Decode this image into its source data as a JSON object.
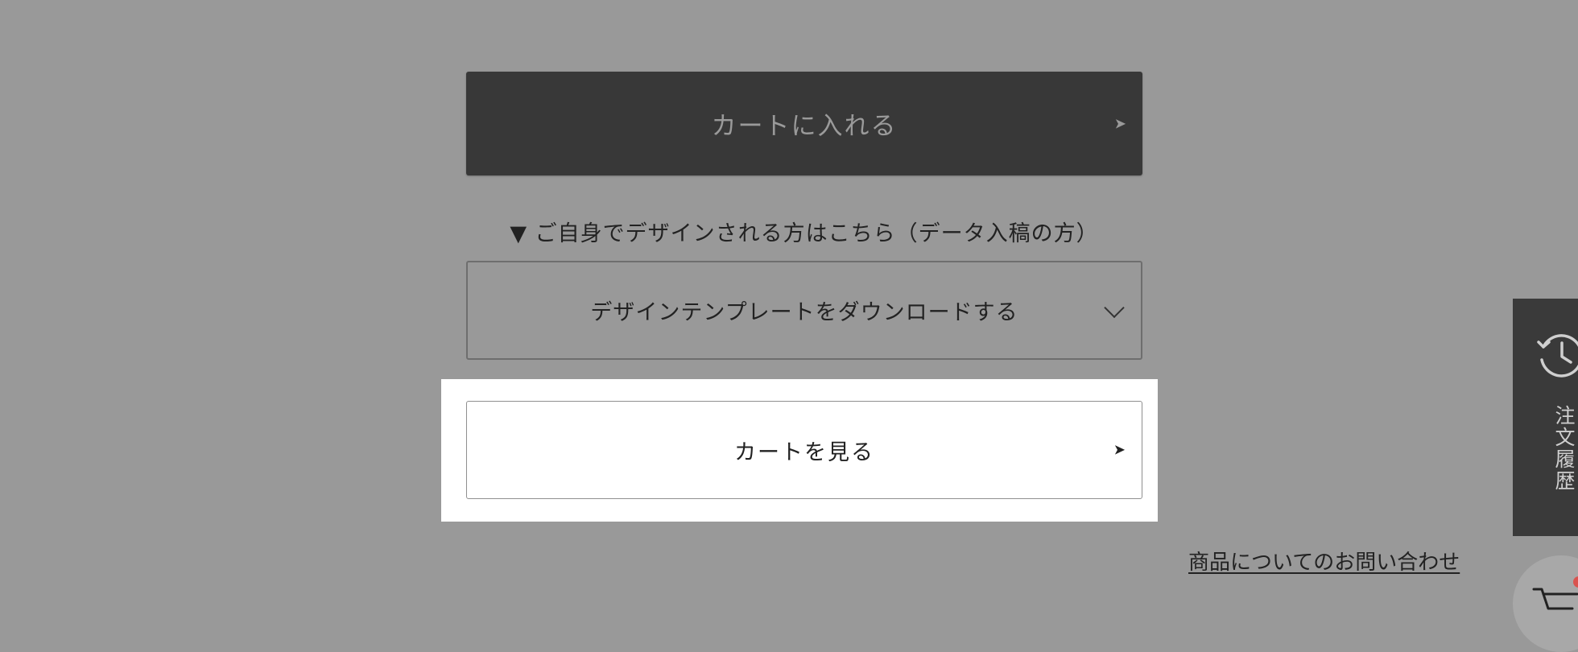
{
  "buttons": {
    "add_to_cart": "カートに入れる",
    "add_to_cart_arrow": "➤",
    "view_cart": "カートを見る",
    "view_cart_arrow": "➤"
  },
  "design_note": "▼ ご自身でデザインされる方はこちら（データ入稿の方）",
  "template_download": {
    "label": "デザインテンプレートをダウンロードする",
    "icon": "chevron-down-icon"
  },
  "contact_link": "商品についてのお問い合わせ",
  "side_tab": {
    "label": "注文履歴",
    "icon": "history-clock-icon"
  },
  "floating_cart": {
    "icon": "cart-icon",
    "badge_color": "#d9534f"
  },
  "colors": {
    "overlay": "#999999",
    "dark_button": "#383838",
    "highlight": "#ffffff"
  }
}
